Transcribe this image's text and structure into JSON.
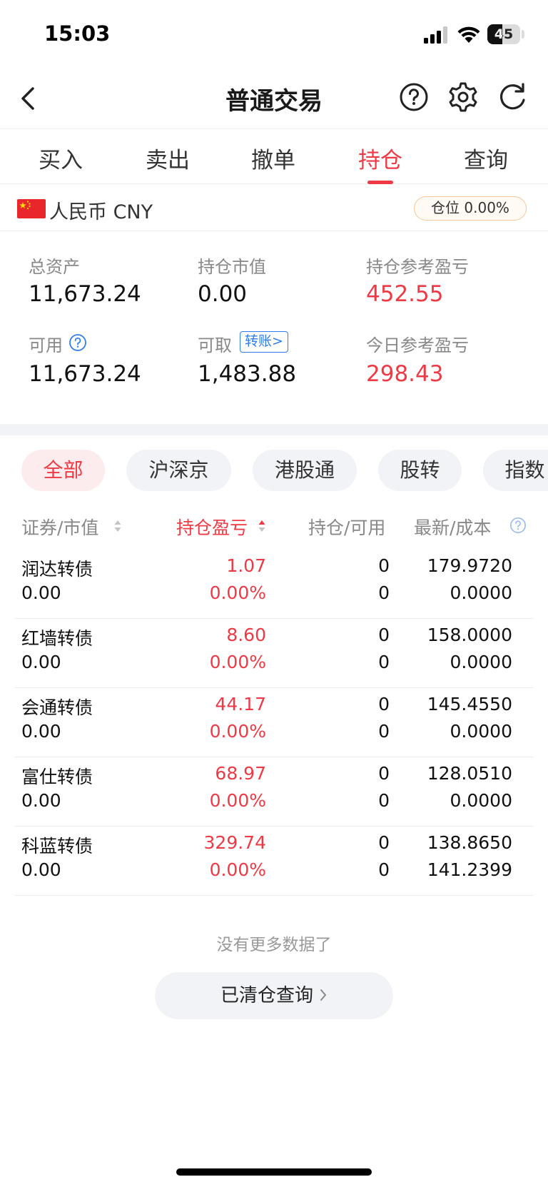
{
  "status": {
    "time": "15:03",
    "battery": "45",
    "battery_level": 0.45
  },
  "nav": {
    "title": "普通交易"
  },
  "tabs": [
    {
      "label": "买入"
    },
    {
      "label": "卖出"
    },
    {
      "label": "撤单"
    },
    {
      "label": "持仓",
      "active": true
    },
    {
      "label": "查询"
    }
  ],
  "account": {
    "currency": "人民币 CNY",
    "position_ratio": "仓位 0.00%"
  },
  "summary": {
    "total_assets_label": "总资产",
    "total_assets": "11,673.24",
    "market_value_label": "持仓市值",
    "market_value": "0.00",
    "position_pnl_label": "持仓参考盈亏",
    "position_pnl": "452.55",
    "available_label": "可用",
    "available": "11,673.24",
    "withdrawable_label": "可取",
    "withdrawable": "1,483.88",
    "transfer_label": "转账>",
    "today_pnl_label": "今日参考盈亏",
    "today_pnl": "298.43"
  },
  "filters": [
    {
      "label": "全部",
      "active": true
    },
    {
      "label": "沪深京"
    },
    {
      "label": "港股通"
    },
    {
      "label": "股转"
    },
    {
      "label": "指数"
    }
  ],
  "table": {
    "headers": {
      "security": "证券/市值",
      "pnl": "持仓盈亏",
      "holding": "持仓/可用",
      "latest": "最新/成本"
    },
    "rows": [
      {
        "name": "润达转债",
        "market_value": "0.00",
        "pnl": "1.07",
        "pnl_pct": "0.00%",
        "holding": "0",
        "available": "0",
        "latest": "179.9720",
        "cost": "0.0000"
      },
      {
        "name": "红墙转债",
        "market_value": "0.00",
        "pnl": "8.60",
        "pnl_pct": "0.00%",
        "holding": "0",
        "available": "0",
        "latest": "158.0000",
        "cost": "0.0000"
      },
      {
        "name": "会通转债",
        "market_value": "0.00",
        "pnl": "44.17",
        "pnl_pct": "0.00%",
        "holding": "0",
        "available": "0",
        "latest": "145.4550",
        "cost": "0.0000"
      },
      {
        "name": "富仕转债",
        "market_value": "0.00",
        "pnl": "68.97",
        "pnl_pct": "0.00%",
        "holding": "0",
        "available": "0",
        "latest": "128.0510",
        "cost": "0.0000"
      },
      {
        "name": "科蓝转债",
        "market_value": "0.00",
        "pnl": "329.74",
        "pnl_pct": "0.00%",
        "holding": "0",
        "available": "0",
        "latest": "138.8650",
        "cost": "141.2399"
      }
    ]
  },
  "footer": {
    "no_more": "没有更多数据了",
    "cleared_query": "已清仓查询"
  },
  "colors": {
    "accent_red": "#ef3a45",
    "link_blue": "#2e7ef0",
    "badge_border": "#f4c89a"
  }
}
